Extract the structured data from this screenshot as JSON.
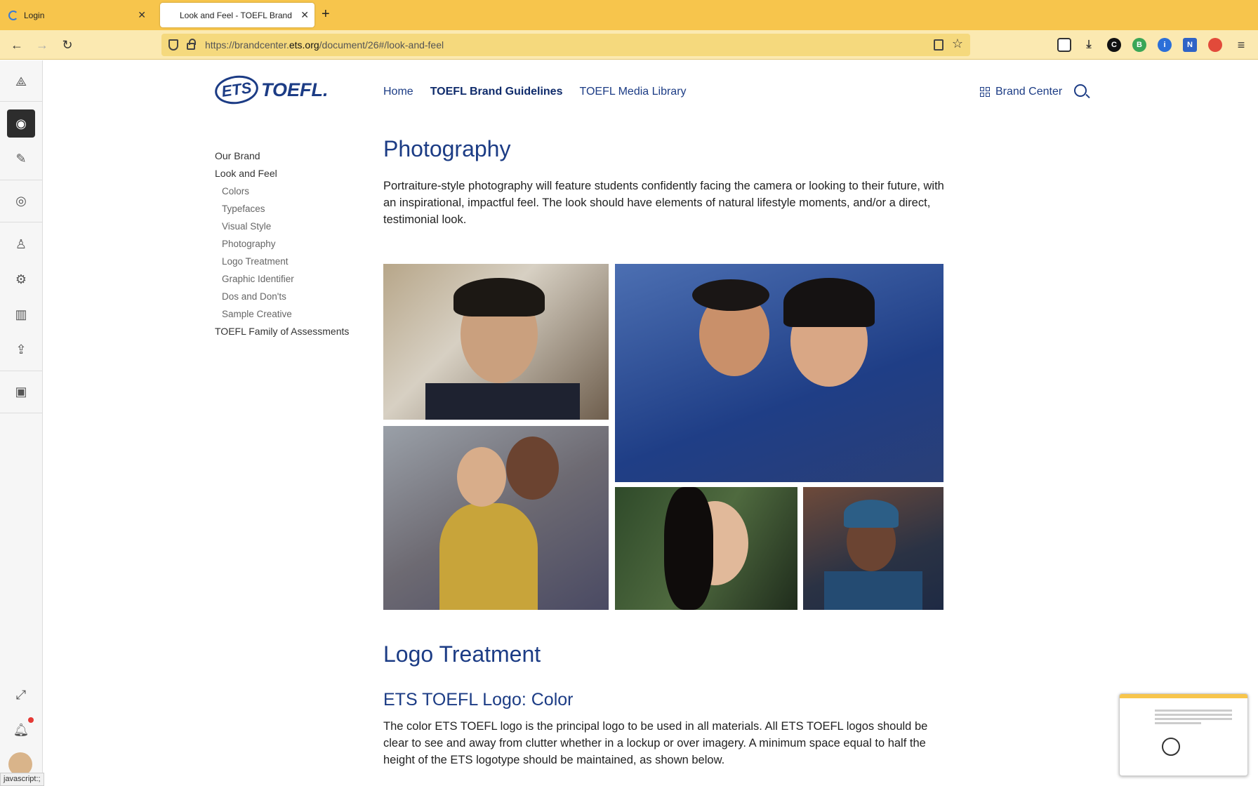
{
  "browser": {
    "tabs": [
      {
        "label": "Login"
      },
      {
        "label": "Look and Feel - TOEFL Brand Guidelines"
      }
    ],
    "url_prefix": "https://brandcenter.",
    "url_domain": "ets.org",
    "url_suffix": "/document/26#/look-and-feel",
    "status_text": "javascript:;"
  },
  "header": {
    "logo_oval": "ETS",
    "logo_word": "TOEFL.",
    "nav": [
      "Home",
      "TOEFL Brand Guidelines",
      "TOEFL Media Library"
    ],
    "brand_center": "Brand Center"
  },
  "leftnav": {
    "our_brand": "Our Brand",
    "look_and_feel": "Look and Feel",
    "subitems": [
      "Colors",
      "Typefaces",
      "Visual Style",
      "Photography",
      "Logo Treatment",
      "Graphic Identifier",
      "Dos and Don'ts",
      "Sample Creative"
    ],
    "family": "TOEFL Family of Assessments"
  },
  "content": {
    "title": "Photography",
    "intro": "Portraiture-style photography will feature students confidently facing the camera or looking to their future, with an inspirational, impactful feel. The look should have elements of natural lifestyle moments, and/or a direct, testimonial look.",
    "section": "Logo Treatment",
    "subsection": "ETS TOEFL Logo: Color",
    "para": "The color ETS TOEFL logo is the principal logo to be used in all materials. All ETS TOEFL logos should be clear to see and away from clutter whether in a lockup or over imagery. A minimum space equal to half the height of the ETS logotype should be maintained, as shown below."
  },
  "colors": {
    "brand_blue": "#1c3c85",
    "browser_accent": "#f7c54c"
  }
}
